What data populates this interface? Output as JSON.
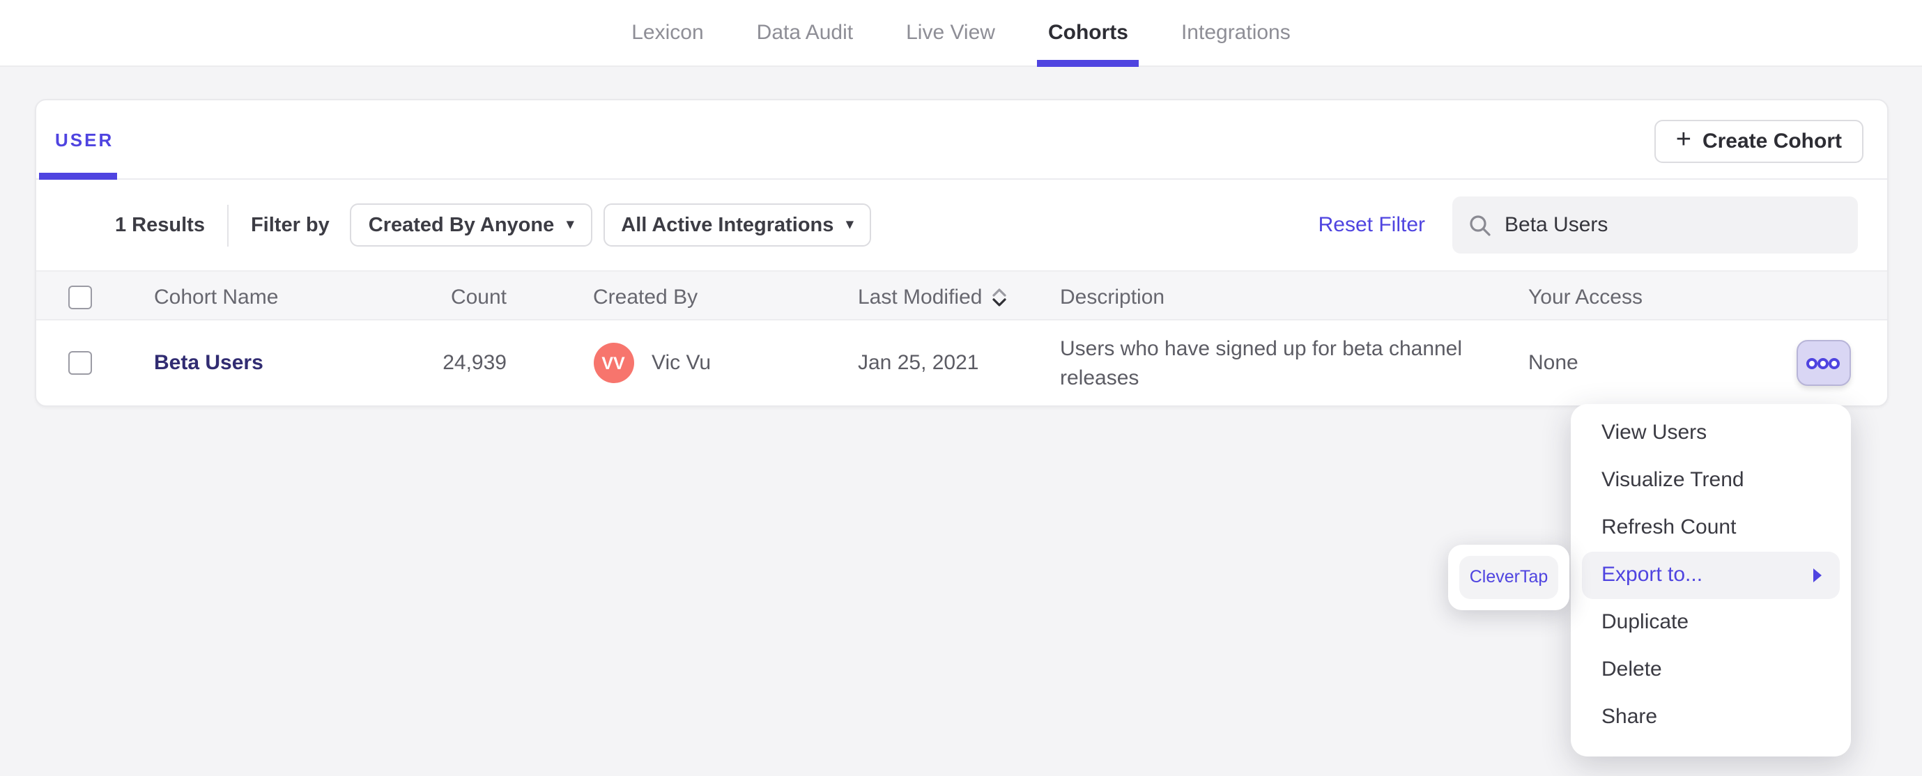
{
  "nav": {
    "tabs": [
      {
        "label": "Lexicon",
        "active": false
      },
      {
        "label": "Data Audit",
        "active": false
      },
      {
        "label": "Live View",
        "active": false
      },
      {
        "label": "Cohorts",
        "active": true
      },
      {
        "label": "Integrations",
        "active": false
      }
    ]
  },
  "card": {
    "tab_label": "USER",
    "create_button": "Create Cohort",
    "plus_icon": "+",
    "results_count": "1 Results",
    "filter_by_label": "Filter by",
    "dropdowns": [
      {
        "label": "Created By Anyone"
      },
      {
        "label": "All Active Integrations"
      }
    ],
    "reset_filter": "Reset Filter",
    "search_value": "Beta Users"
  },
  "table": {
    "headers": [
      "Cohort Name",
      "Count",
      "Created By",
      "Last Modified",
      "Description",
      "Your Access"
    ],
    "sorted_column": "Last Modified",
    "rows": [
      {
        "name": "Beta Users",
        "count": "24,939",
        "avatar_initials": "VV",
        "created_by": "Vic Vu",
        "last_modified": "Jan 25, 2021",
        "description": "Users who have signed up for beta channel releases",
        "access": "None"
      }
    ]
  },
  "context_menu": {
    "items": [
      "View Users",
      "Visualize Trend",
      "Refresh Count",
      "Export to...",
      "Duplicate",
      "Delete",
      "Share"
    ],
    "highlighted_item": "Export to..."
  },
  "submenu": {
    "items": [
      "CleverTap"
    ]
  },
  "colors": {
    "accent_purple": "#4f44e0",
    "cohort_link": "#312c72",
    "avatar_coral": "#f7756d",
    "page_background": "#f4f4f6",
    "dots_button_background": "#d9d6f4",
    "menu_highlight": "#f2f2f5"
  }
}
